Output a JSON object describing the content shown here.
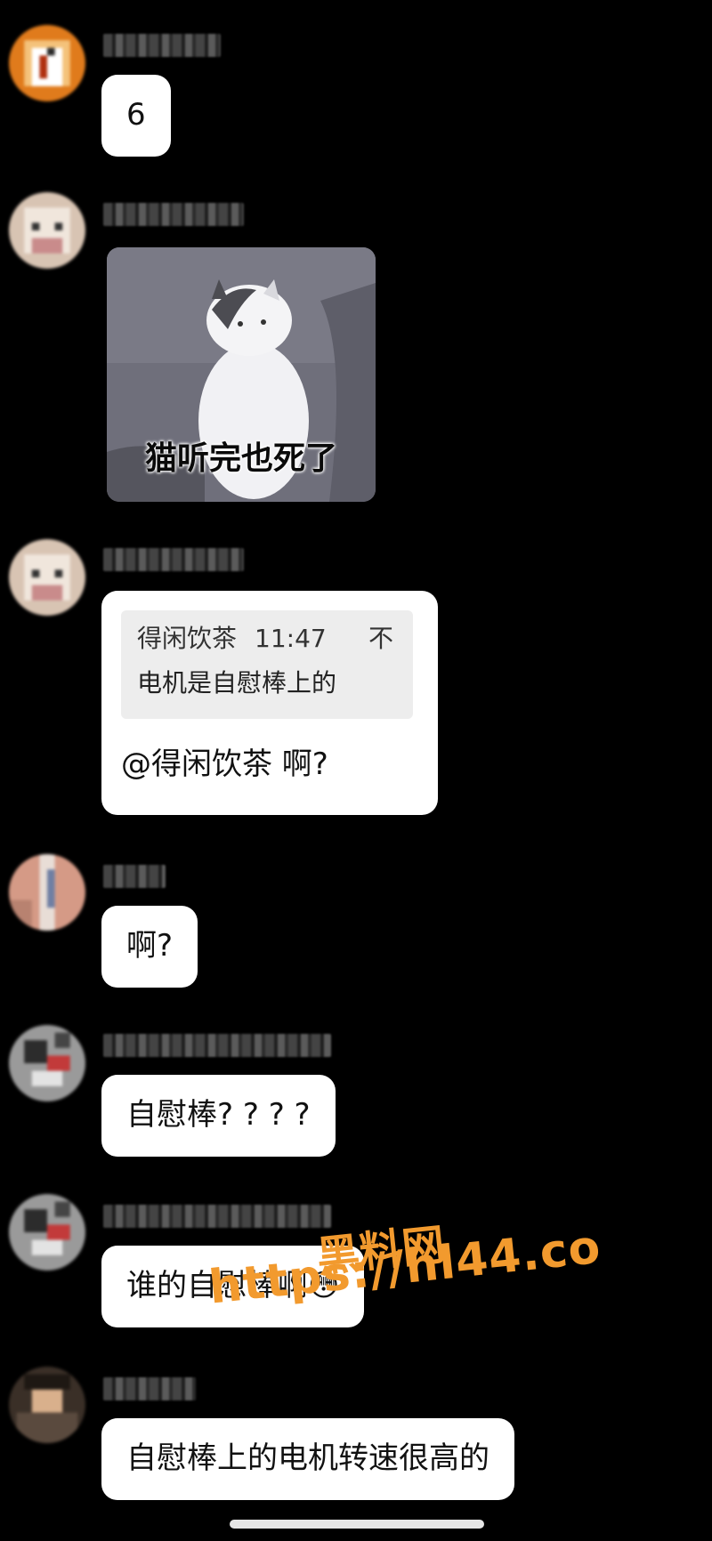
{
  "messages": [
    {
      "kind": "text",
      "text": "6"
    },
    {
      "kind": "sticker",
      "caption": "猫听完也死了"
    },
    {
      "kind": "quote",
      "quote_author": "得闲饮茶",
      "quote_time": "11:47",
      "quote_flag": "不",
      "quote_text": "电机是自慰棒上的",
      "text": "@得闲饮茶 啊?"
    },
    {
      "kind": "text",
      "text": "啊?"
    },
    {
      "kind": "text",
      "text": "自慰棒? ? ? ?"
    },
    {
      "kind": "text",
      "text": "谁的自慰棒啊😳"
    },
    {
      "kind": "text",
      "text": "自慰棒上的电机转速很高的"
    }
  ],
  "watermark": {
    "line1": "黑料网",
    "line2": "https://hl44.co"
  },
  "colors": {
    "background": "#000000",
    "bubble": "#ffffff",
    "watermark": "#f29a2e",
    "quote_bg": "#ededed"
  },
  "icons": [
    "avatar-pixel-orange",
    "avatar-cat",
    "avatar-cat",
    "avatar-pink",
    "avatar-gray",
    "avatar-gray",
    "avatar-dark"
  ]
}
